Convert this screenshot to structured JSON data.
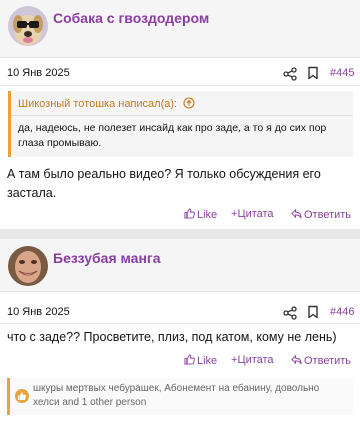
{
  "posts": [
    {
      "author": "Собака с гвоздодером",
      "date": "10 Янв 2025",
      "number": "#445",
      "quote": {
        "header": "Шикозный тотошка написал(а):",
        "text": "да, надеюсь, не полезет инсайд как про заде, а то я до сих пор глаза промываю."
      },
      "text": "А там было реально видео? Я только обсуждения его застала.",
      "actions": {
        "like": "Like",
        "quote": "Цитата",
        "reply": "Ответить"
      }
    },
    {
      "author": "Беззубая манга",
      "date": "10 Янв 2025",
      "number": "#446",
      "text": "что с заде?? Просветите, плиз, под катом, кому не лень)",
      "actions": {
        "like": "Like",
        "quote": "Цитата",
        "reply": "Ответить"
      },
      "reactions": "шкуры мертвых чебурашек, Абонемент на ебанину, довольно хелси and 1 other person"
    }
  ],
  "icons": {
    "share": "share-icon",
    "bookmark": "bookmark-icon",
    "like": "thumbs-up-icon",
    "quote": "plus-icon",
    "reply": "reply-arrow-icon",
    "quote_arrow": "circle-up-arrow-icon"
  },
  "colors": {
    "accent": "#8a3fa0",
    "quote_border": "#e9a33a",
    "quote_header": "#c27a1e"
  }
}
